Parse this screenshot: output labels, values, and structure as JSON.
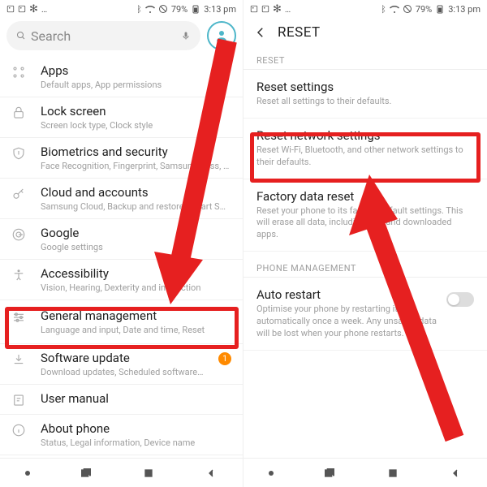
{
  "statusbar": {
    "battery": "79%",
    "time": "3:13 pm"
  },
  "left": {
    "search": {
      "placeholder": "Search"
    },
    "items": [
      {
        "title": "Apps",
        "sub": "Default apps, App permissions"
      },
      {
        "title": "Lock screen",
        "sub": "Screen lock type, Clock style"
      },
      {
        "title": "Biometrics and security",
        "sub": "Face Recognition, Fingerprint, Samsung Pass, F…"
      },
      {
        "title": "Cloud and accounts",
        "sub": "Samsung Cloud, Backup and restore, Smart Swi…"
      },
      {
        "title": "Google",
        "sub": "Google settings"
      },
      {
        "title": "Accessibility",
        "sub": "Vision, Hearing, Dexterity and interaction"
      },
      {
        "title": "General management",
        "sub": "Language and input, Date and time, Reset"
      },
      {
        "title": "Software update",
        "sub": "Download updates, Scheduled software…",
        "badge": "1"
      },
      {
        "title": "User manual",
        "sub": ""
      },
      {
        "title": "About phone",
        "sub": "Status, Legal information, Device name"
      }
    ]
  },
  "right": {
    "header": "RESET",
    "section1": "RESET",
    "entries": [
      {
        "title": "Reset settings",
        "sub": "Reset all settings to their defaults."
      },
      {
        "title": "Reset network settings",
        "sub": "Reset Wi-Fi, Bluetooth, and other network settings to their defaults."
      },
      {
        "title": "Factory data reset",
        "sub": "Reset your phone to its factory default settings. This will erase all data, including files and downloaded apps."
      }
    ],
    "section2": "PHONE MANAGEMENT",
    "auto": {
      "title": "Auto restart",
      "sub": "Optimise your phone by restarting it automatically once a week. Any unsaved data will be lost when your phone restarts."
    }
  },
  "highlights": {
    "general_management": true,
    "reset_network": true
  },
  "colors": {
    "accent_red": "#e62020",
    "accent_teal": "#4db6c9",
    "badge_orange": "#ff8a00"
  }
}
